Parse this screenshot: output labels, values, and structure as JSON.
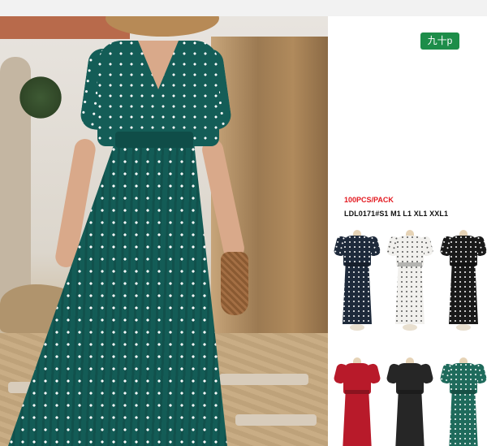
{
  "badge": {
    "label": "九十p"
  },
  "product": {
    "pack": "100PCS/PACK",
    "code_sizes": "LDL0171#S1 M1 L1 XL1 XXL1"
  },
  "variants": [
    {
      "name": "navy",
      "color": "#1e2a3b"
    },
    {
      "name": "white",
      "color": "#f1f0ed"
    },
    {
      "name": "black",
      "color": "#1a1a1a"
    },
    {
      "name": "red",
      "color": "#b81a2a"
    },
    {
      "name": "black-satin",
      "color": "#262626"
    },
    {
      "name": "teal",
      "color": "#1f6b5c"
    }
  ],
  "main_photo": {
    "dress_color": "#145d57"
  }
}
